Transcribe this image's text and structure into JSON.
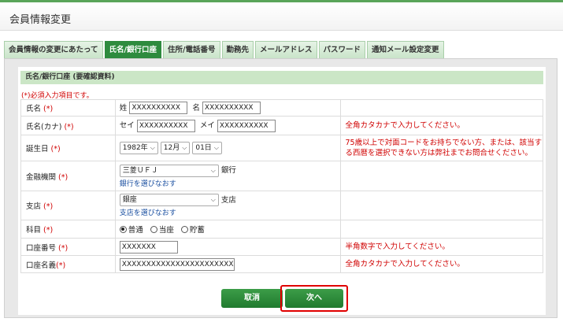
{
  "header": {
    "title": "会員情報変更"
  },
  "tabs": [
    {
      "label": "会員情報の変更にあたって"
    },
    {
      "label": "氏名/銀行口座"
    },
    {
      "label": "住所/電話番号"
    },
    {
      "label": "勤務先"
    },
    {
      "label": "メールアドレス"
    },
    {
      "label": "パスワード"
    },
    {
      "label": "通知メール設定変更"
    }
  ],
  "section": {
    "title": "氏名/銀行口座 (要確認資料)",
    "required_note": "(*)必須入力項目です。"
  },
  "required_mark": "(*)",
  "fields": {
    "name": {
      "label": "氏名",
      "last_prefix": "姓",
      "last_value": "XXXXXXXXXX",
      "first_prefix": "名",
      "first_value": "XXXXXXXXXX"
    },
    "kana": {
      "label": "氏名(カナ)",
      "last_prefix": "セイ",
      "last_value": "XXXXXXXXXX",
      "first_prefix": "メイ",
      "first_value": "XXXXXXXXXX",
      "note": "全角カタカナで入力してください。"
    },
    "birthday": {
      "label": "誕生日",
      "year": "1982年",
      "month": "12月",
      "day": "01日",
      "note": "75歳以上で対面コードをお持ちでない方、または、該当する西暦を選択できない方は弊社までお問合せください。"
    },
    "bank": {
      "label": "金融機関",
      "value": "三菱ＵＦＪ",
      "suffix": "銀行",
      "link": "銀行を選びなおす"
    },
    "branch": {
      "label": "支店",
      "value": "銀座",
      "suffix": "支店",
      "link": "支店を選びなおす"
    },
    "account_type": {
      "label": "科目",
      "options": [
        "普通",
        "当座",
        "貯蓄"
      ],
      "selected": "普通"
    },
    "account_number": {
      "label": "口座番号",
      "value": "XXXXXXX",
      "note": "半角数字で入力してください。"
    },
    "account_name": {
      "label": "口座名義",
      "value": "XXXXXXXXXXXXXXXXXXXXXXX",
      "note": "全角カタカナで入力してください。"
    }
  },
  "buttons": {
    "cancel": "取消",
    "next": "次へ"
  }
}
